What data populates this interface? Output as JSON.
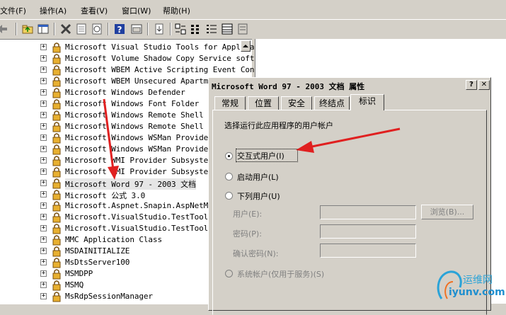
{
  "menu": [
    "文件(F)",
    "操作(A)",
    "查看(V)",
    "窗口(W)",
    "帮助(H)"
  ],
  "toolbar": {
    "icons": [
      "back-arrow-icon",
      "forward-arrow-icon",
      "up-folder-icon",
      "show-hide-tree-icon",
      "delete-icon",
      "properties-icon",
      "refresh-icon",
      "help-icon",
      "view-icon",
      "export-icon",
      "large-icons-view-icon",
      "small-icons-view-icon",
      "list-view-icon",
      "detail-view-icon"
    ]
  },
  "tree": {
    "items": [
      {
        "label": "Microsoft Visual Studio Tools for Applica"
      },
      {
        "label": "Microsoft Volume Shadow Copy Service soft"
      },
      {
        "label": "Microsoft WBEM Active Scripting Event Con"
      },
      {
        "label": "Microsoft WBEM Unsecured Apartment"
      },
      {
        "label": "Microsoft Windows Defender"
      },
      {
        "label": "Microsoft Windows Font Folder"
      },
      {
        "label": "Microsoft Windows Remote Shell Host"
      },
      {
        "label": "Microsoft Windows Remote Shell Host"
      },
      {
        "label": "Microsoft Windows WSMan Provider Host"
      },
      {
        "label": "Microsoft Windows WSMan Provider Host"
      },
      {
        "label": "Microsoft WMI Provider Subsystem Host"
      },
      {
        "label": "Microsoft WMI Provider Subsystem Secure"
      },
      {
        "label": "Microsoft Word 97 - 2003 文档",
        "selected": true
      },
      {
        "label": "Microsoft 公式 3.0"
      },
      {
        "label": "Microsoft.Aspnet.Snapin.AspNetManagement"
      },
      {
        "label": "Microsoft.VisualStudio.TestTools.U"
      },
      {
        "label": "Microsoft.VisualStudio.TestTools.U"
      },
      {
        "label": "MMC Application Class"
      },
      {
        "label": "MSDAINITIALIZE"
      },
      {
        "label": "MsDtsServer100"
      },
      {
        "label": "MSMDPP"
      },
      {
        "label": "MSMQ"
      },
      {
        "label": "MsRdpSessionManager"
      }
    ]
  },
  "dialog": {
    "title": "Microsoft Word 97 - 2003 文档 属性",
    "help_btn": "?",
    "close_btn": "✕",
    "tabs": [
      "常规",
      "位置",
      "安全",
      "终结点",
      "标识"
    ],
    "active_tab": "标识",
    "prompt": "选择运行此应用程序的用户帐户",
    "options": {
      "interactive": "交互式用户(I)",
      "launching": "启动用户(L)",
      "this_user": "下列用户(U)",
      "system": "系统帐户(仅用于服务)(S)"
    },
    "selected_option": "interactive",
    "fields": {
      "user_label": "用户(E):",
      "password_label": "密码(P):",
      "confirm_label": "确认密码(N):",
      "browse": "浏览(B)..."
    }
  },
  "watermark": {
    "line1": "运维网",
    "line2": "iyunv.com"
  },
  "colors": {
    "arrow": "#e02020",
    "selection": "#e6e6e6",
    "watermark": "#2aa3d8"
  }
}
